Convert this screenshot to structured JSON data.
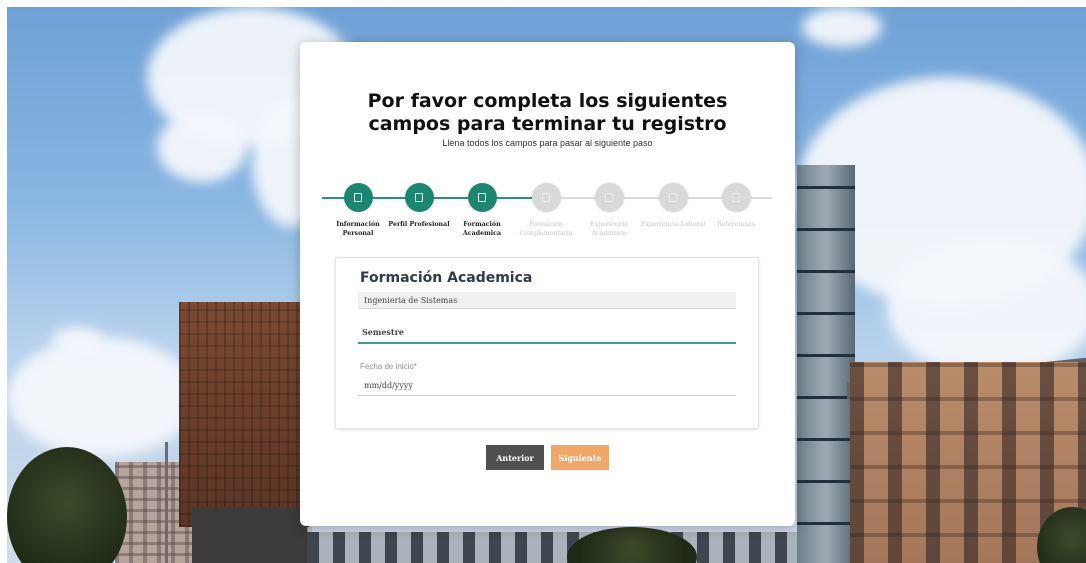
{
  "page": {
    "title": "Por favor completa los siguientes campos para terminar tu registro",
    "subtitle": "Llena todos los campos para pasar al siguiente paso"
  },
  "stepper": {
    "active_color": "#1c8671",
    "inactive_color": "#d9d9d9",
    "steps": [
      {
        "label": "Información\nPersonal",
        "state": "completed"
      },
      {
        "label": "Perfil Profesional",
        "state": "completed"
      },
      {
        "label": "Formación\nAcademica",
        "state": "current"
      },
      {
        "label": "Formación\nComplementaria",
        "state": "pending"
      },
      {
        "label": "Experiencia\nAcademica",
        "state": "pending"
      },
      {
        "label": "Experiencia Laboral",
        "state": "pending"
      },
      {
        "label": "Referencias",
        "state": "pending"
      }
    ]
  },
  "form": {
    "title": "Formación Academica",
    "program_select": {
      "value": "Ingenieria de Sistemas"
    },
    "semester_input": {
      "placeholder": "Semestre",
      "value": ""
    },
    "start_date": {
      "label": "Fecha de inicio*",
      "placeholder": "mm/dd/yyyy"
    }
  },
  "buttons": {
    "prev_label": "Anterior",
    "next_label": "Siguiente",
    "prev_color": "#505050",
    "next_color": "#f0a868"
  }
}
